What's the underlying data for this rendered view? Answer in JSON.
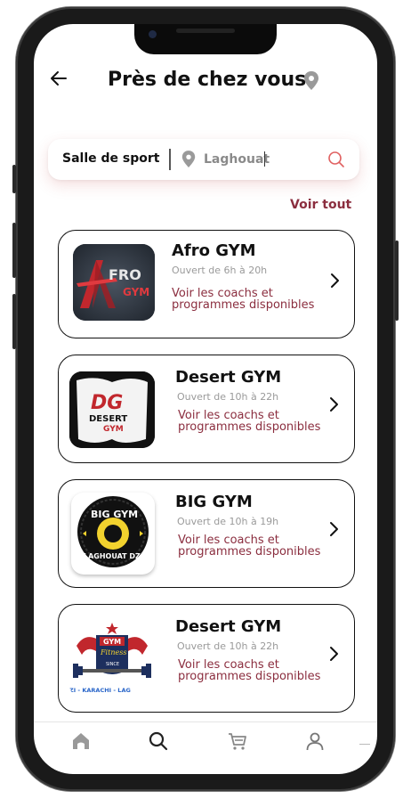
{
  "header": {
    "title": "Près de chez vous",
    "back_icon": "arrow-left-icon",
    "location_icon": "map-pin-icon"
  },
  "search": {
    "category": "Salle de sport",
    "location_value": "Laghouat",
    "search_icon": "search-icon"
  },
  "see_all": "Voir tout",
  "colors": {
    "accent": "#8b2e3f",
    "muted": "#9a9a9a",
    "search_icon": "#e06060"
  },
  "gyms": [
    {
      "name": "Afro GYM",
      "hours": "Ouvert de 6h à 20h",
      "link": "Voir les coachs et programmes disponibles",
      "logo_text": [
        "FRO",
        "GYM"
      ]
    },
    {
      "name": "Desert GYM",
      "hours": "Ouvert de 10h à 22h",
      "link": "Voir les coachs et programmes disponibles",
      "logo_text": [
        "DG",
        "DESERT",
        "GYM"
      ]
    },
    {
      "name": "BIG GYM",
      "hours": "Ouvert de 10h à 19h",
      "link": "Voir les coachs et programmes disponibles",
      "logo_text": [
        "BIG GYM",
        "LAGHOUAT DZ"
      ]
    },
    {
      "name": "Desert GYM",
      "hours": "Ouvert de 10h à 22h",
      "link": "Voir les coachs et programmes disponibles",
      "logo_text": [
        "GYM",
        "Fitness",
        "SINCE",
        "ZI - KARACHI - LAG"
      ]
    }
  ],
  "nav": [
    {
      "name": "home",
      "icon": "home-icon"
    },
    {
      "name": "search",
      "icon": "search-icon"
    },
    {
      "name": "cart",
      "icon": "cart-icon"
    },
    {
      "name": "profile",
      "icon": "user-icon"
    }
  ]
}
